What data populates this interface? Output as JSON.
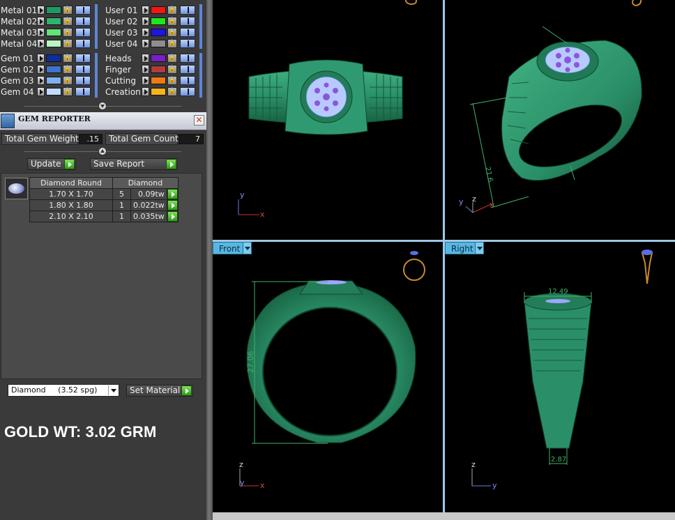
{
  "materials_left": [
    {
      "name": "Metal 01",
      "color": "#1f9a63"
    },
    {
      "name": "Metal 02",
      "color": "#2fb36d"
    },
    {
      "name": "Metal 03",
      "color": "#63e275"
    },
    {
      "name": "Metal 04",
      "color": "#b8f5c2"
    },
    {
      "name": "Gem 01",
      "color": "#0c2f9c"
    },
    {
      "name": "Gem 02",
      "color": "#3f73cc"
    },
    {
      "name": "Gem 03",
      "color": "#7fb0f0"
    },
    {
      "name": "Gem 04",
      "color": "#c2dcff"
    }
  ],
  "materials_right": [
    {
      "name": "User 01",
      "color": "#ef1818"
    },
    {
      "name": "User 02",
      "color": "#22e41e"
    },
    {
      "name": "User 03",
      "color": "#1b16e0"
    },
    {
      "name": "User 04",
      "color": "#8e8e8e"
    },
    {
      "name": "Heads",
      "color": "#7a1fc7"
    },
    {
      "name": "Finger",
      "color": "#b23c3c"
    },
    {
      "name": "Cutting",
      "color": "#f07a12"
    },
    {
      "name": "Creation",
      "color": "#f6b31a"
    }
  ],
  "gem_reporter": {
    "title": "GEM REPORTER",
    "close": "✕",
    "total_weight_label": "Total Gem Weight",
    "total_weight_value": ".15",
    "total_count_label": "Total Gem Count",
    "total_count_value": "7",
    "update_label": "Update",
    "save_label": "Save Report",
    "table": {
      "headers": [
        "Diamond Round",
        "Diamond"
      ],
      "rows": [
        {
          "size": "1.70 X 1.70",
          "count": "5",
          "weight": "0.09tw"
        },
        {
          "size": "1.80 X 1.80",
          "count": "1",
          "weight": "0.022tw"
        },
        {
          "size": "2.10 X 2.10",
          "count": "1",
          "weight": "0.035tw"
        }
      ]
    },
    "material_select": "Diamond     (3.52 spg)",
    "set_material_label": "Set Material"
  },
  "gold_weight_text": "GOLD WT: 3.02 GRM",
  "viewports": {
    "front": {
      "label": "Front",
      "dim_height": "27.06"
    },
    "right": {
      "label": "Right",
      "dim_width": "12.49",
      "dim_bottom": "2.87"
    },
    "perspective": {
      "dim_label": "21.6"
    },
    "axes": {
      "x": "x",
      "y": "y",
      "z": "z"
    }
  },
  "colors": {
    "ring_green": "#2a8f68",
    "ring_green_dark": "#17603f",
    "gem_purple": "#8b57d8",
    "viewport_tab": "#58b7e2",
    "dim_line": "#3fb36a"
  }
}
